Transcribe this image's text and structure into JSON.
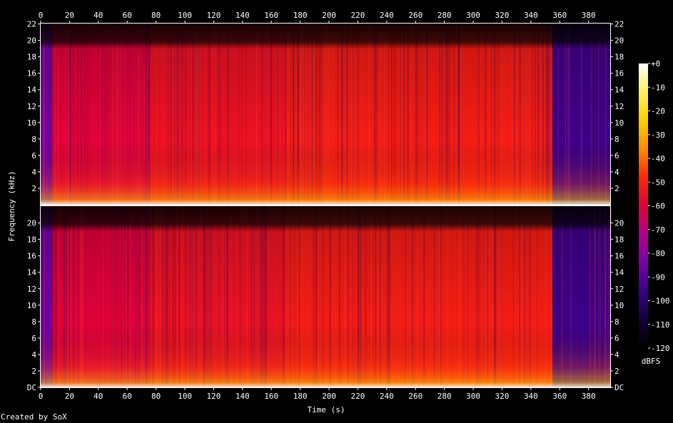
{
  "chart_data": {
    "type": "heatmap",
    "title": "",
    "xlabel": "Time (s)",
    "ylabel": "Frequency (kHz)",
    "x_ticks": [
      "0",
      "20",
      "40",
      "60",
      "80",
      "100",
      "120",
      "140",
      "160",
      "180",
      "200",
      "220",
      "240",
      "260",
      "280",
      "300",
      "320",
      "340",
      "360",
      "380"
    ],
    "xlim": [
      0,
      395
    ],
    "ylim_khz": [
      0,
      22.05
    ],
    "channels": [
      {
        "y_ticks": [
          "2",
          "4",
          "6",
          "8",
          "10",
          "12",
          "14",
          "16",
          "18",
          "20",
          "22"
        ]
      },
      {
        "y_ticks": [
          "DC",
          "2",
          "4",
          "6",
          "8",
          "10",
          "12",
          "14",
          "16",
          "18",
          "20"
        ]
      }
    ],
    "colorbar": {
      "label": "dBFS",
      "ticks": [
        "+0",
        "-10",
        "-20",
        "-30",
        "-40",
        "-50",
        "-60",
        "-70",
        "-80",
        "-90",
        "-100",
        "-110",
        "-120"
      ],
      "range_db": [
        -120,
        0
      ],
      "colors": [
        "#000000",
        "#14003a",
        "#3a0089",
        "#7800a8",
        "#b0008c",
        "#e0003a",
        "#ff2a00",
        "#ff8a00",
        "#ffd000",
        "#fff25a",
        "#ffffff"
      ]
    },
    "segments": [
      {
        "start": 0,
        "end": 8,
        "level": -85
      },
      {
        "start": 8,
        "end": 76,
        "level": -60
      },
      {
        "start": 76,
        "end": 170,
        "level": -55
      },
      {
        "start": 170,
        "end": 355,
        "level": -52
      },
      {
        "start": 355,
        "end": 395,
        "level": -95
      }
    ]
  },
  "footer": {
    "credit": "Created by SoX"
  }
}
